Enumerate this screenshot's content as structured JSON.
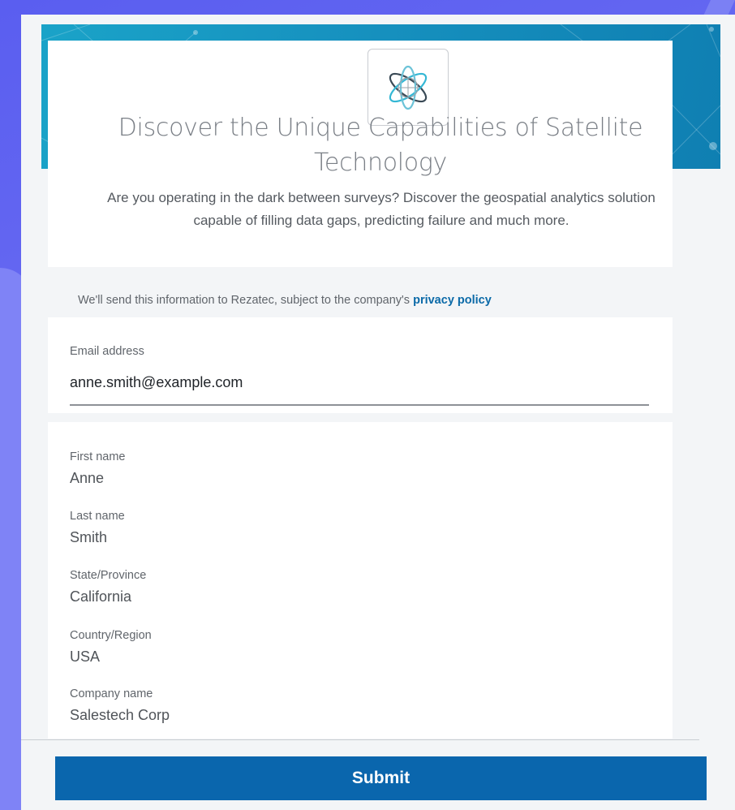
{
  "hero": {
    "title": "Discover the Unique Capabilities of Satellite Technology",
    "description": "Are you operating in the dark between surveys? Discover the geospatial analytics solution capable of filling data gaps, predicting failure and much more."
  },
  "privacy": {
    "text": "We'll send this information to Rezatec, subject to the company's ",
    "link_label": "privacy policy"
  },
  "email": {
    "label": "Email address",
    "value": "anne.smith@example.com"
  },
  "fields": [
    {
      "label": "First name",
      "value": "Anne"
    },
    {
      "label": "Last name",
      "value": "Smith"
    },
    {
      "label": "State/Province",
      "value": "California"
    },
    {
      "label": "Country/Region",
      "value": "USA"
    },
    {
      "label": "Company name",
      "value": "Salestech Corp"
    }
  ],
  "submit_label": "Submit",
  "colors": {
    "accent": "#0a66ad",
    "banner": "#1793c0",
    "background": "#5a5ef0"
  },
  "logo_icon": "satellite-orbit-icon"
}
